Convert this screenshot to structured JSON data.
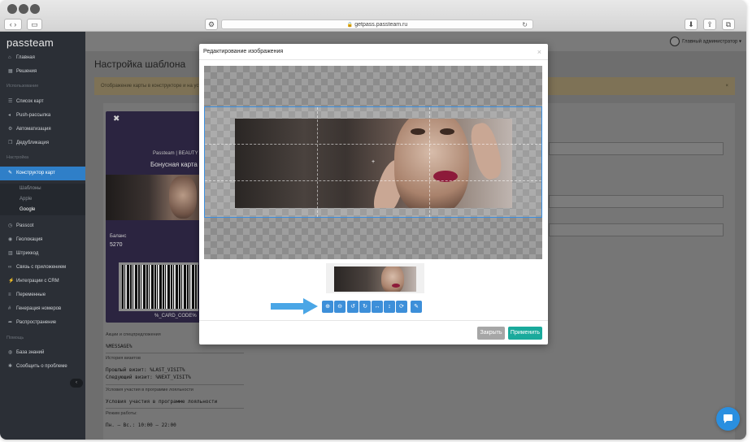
{
  "browser": {
    "url": "getpass.passteam.ru",
    "lock_icon": "lock-icon",
    "reload_icon": "reload-icon"
  },
  "app": {
    "logo": "passteam",
    "admin": "Главный администратор",
    "page_title": "Настройка шаблона",
    "notice": "Отображение карты в конструкторе и на уст",
    "notice_close": "×"
  },
  "sidebar": {
    "main": [
      {
        "label": "Главная",
        "icon": "home-icon"
      },
      {
        "label": "Решения",
        "icon": "grid-icon"
      }
    ],
    "section_usage": "Использование",
    "usage": [
      {
        "label": "Список карт",
        "icon": "list-icon"
      },
      {
        "label": "Push-рассылка",
        "icon": "bullhorn-icon"
      },
      {
        "label": "Автоматизация",
        "icon": "gear-icon"
      },
      {
        "label": "Дедубликация",
        "icon": "copy-icon"
      }
    ],
    "section_settings": "Настройка",
    "constructor": "Конструктор карт",
    "sub": [
      "Шаблоны",
      "Apple",
      "Google"
    ],
    "settings": [
      {
        "label": "Passcot",
        "icon": "clock-icon"
      },
      {
        "label": "Геолокация",
        "icon": "pin-icon"
      },
      {
        "label": "Штрихкод",
        "icon": "barcode-icon"
      },
      {
        "label": "Связь с приложением",
        "icon": "link-icon"
      },
      {
        "label": "Интеграции с CRM",
        "icon": "plug-icon"
      },
      {
        "label": "Переменные",
        "icon": "variable-icon"
      },
      {
        "label": "Генерация номеров",
        "icon": "numbers-icon"
      },
      {
        "label": "Распространение",
        "icon": "share-icon"
      }
    ],
    "section_help": "Помощь",
    "help": [
      {
        "label": "База знаний",
        "icon": "globe-icon"
      },
      {
        "label": "Сообщить о проблеме",
        "icon": "bug-icon"
      }
    ],
    "collapse": "‹"
  },
  "card": {
    "close": "✖",
    "brand": "Passteam | BEAUTY",
    "title": "Бонусная карта",
    "balance_label": "Баланс",
    "balance_value": "5270",
    "code": "%_CARD_CODE%"
  },
  "info": {
    "promo_label": "Акции и спецпредложения",
    "message": "%MESSAGE%",
    "history_label": "История визитов",
    "last_visit": "Прошлый визит: %LAST_VISIT%",
    "next_visit": "Следующий визит:  %NEXT_VISIT%",
    "terms_label": "Условия участия в программе лояльности",
    "terms_value": "Условия участия в программе лояльности",
    "hours_label": "Режим работы:",
    "hours_value": "Пн. — Вс.: 10:00 — 22:00"
  },
  "modal": {
    "title": "Редактирование изображения",
    "close": "×",
    "tools": [
      "zoom-in-icon",
      "zoom-out-icon",
      "rotate-left-icon",
      "rotate-right-icon",
      "flip-horizontal-icon",
      "flip-vertical-icon",
      "reset-icon",
      "brush-icon"
    ],
    "tool_glyphs": [
      "⊕",
      "⊖",
      "↺",
      "↻",
      "↔",
      "↕",
      "⟳",
      "✎"
    ],
    "btn_close": "Закрыть",
    "btn_apply": "Применить"
  },
  "colors": {
    "accent": "#3d8fd9",
    "apply": "#1aaa9c",
    "sidebar": "#2b2f36",
    "active": "#2f7fc8"
  }
}
